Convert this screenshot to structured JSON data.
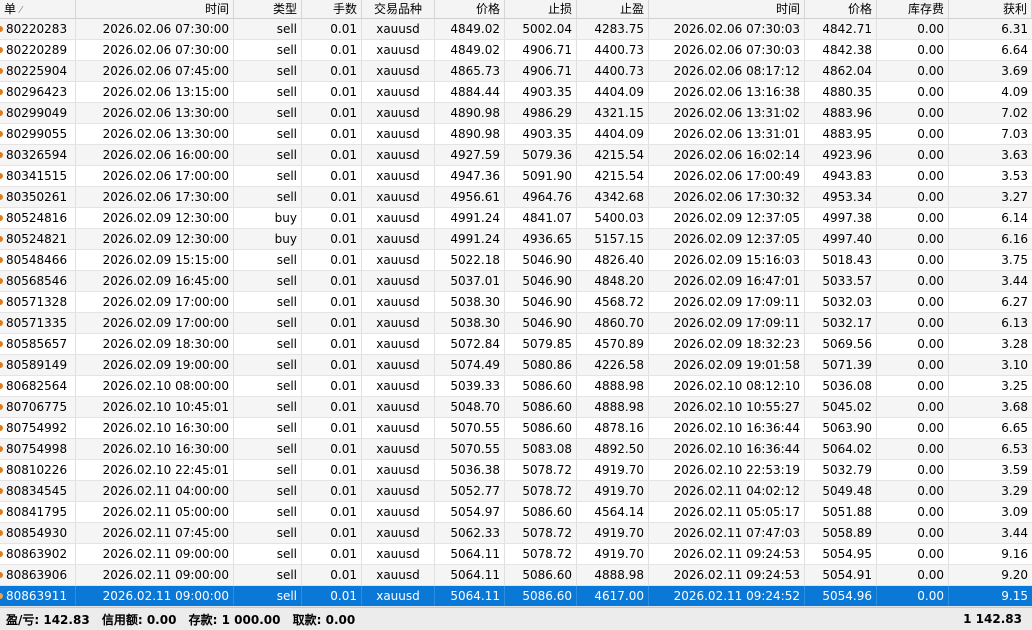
{
  "columns": [
    "单",
    "时间",
    "类型",
    "手数",
    "交易品种",
    "价格",
    "止损",
    "止盈",
    "时间",
    "价格",
    "库存费",
    "获利"
  ],
  "rows": [
    [
      "80220283",
      "2026.02.06 07:30:00",
      "sell",
      "0.01",
      "xauusd",
      "4849.02",
      "5002.04",
      "4283.75",
      "2026.02.06 07:30:03",
      "4842.71",
      "0.00",
      "6.31"
    ],
    [
      "80220289",
      "2026.02.06 07:30:00",
      "sell",
      "0.01",
      "xauusd",
      "4849.02",
      "4906.71",
      "4400.73",
      "2026.02.06 07:30:03",
      "4842.38",
      "0.00",
      "6.64"
    ],
    [
      "80225904",
      "2026.02.06 07:45:00",
      "sell",
      "0.01",
      "xauusd",
      "4865.73",
      "4906.71",
      "4400.73",
      "2026.02.06 08:17:12",
      "4862.04",
      "0.00",
      "3.69"
    ],
    [
      "80296423",
      "2026.02.06 13:15:00",
      "sell",
      "0.01",
      "xauusd",
      "4884.44",
      "4903.35",
      "4404.09",
      "2026.02.06 13:16:38",
      "4880.35",
      "0.00",
      "4.09"
    ],
    [
      "80299049",
      "2026.02.06 13:30:00",
      "sell",
      "0.01",
      "xauusd",
      "4890.98",
      "4986.29",
      "4321.15",
      "2026.02.06 13:31:02",
      "4883.96",
      "0.00",
      "7.02"
    ],
    [
      "80299055",
      "2026.02.06 13:30:00",
      "sell",
      "0.01",
      "xauusd",
      "4890.98",
      "4903.35",
      "4404.09",
      "2026.02.06 13:31:01",
      "4883.95",
      "0.00",
      "7.03"
    ],
    [
      "80326594",
      "2026.02.06 16:00:00",
      "sell",
      "0.01",
      "xauusd",
      "4927.59",
      "5079.36",
      "4215.54",
      "2026.02.06 16:02:14",
      "4923.96",
      "0.00",
      "3.63"
    ],
    [
      "80341515",
      "2026.02.06 17:00:00",
      "sell",
      "0.01",
      "xauusd",
      "4947.36",
      "5091.90",
      "4215.54",
      "2026.02.06 17:00:49",
      "4943.83",
      "0.00",
      "3.53"
    ],
    [
      "80350261",
      "2026.02.06 17:30:00",
      "sell",
      "0.01",
      "xauusd",
      "4956.61",
      "4964.76",
      "4342.68",
      "2026.02.06 17:30:32",
      "4953.34",
      "0.00",
      "3.27"
    ],
    [
      "80524816",
      "2026.02.09 12:30:00",
      "buy",
      "0.01",
      "xauusd",
      "4991.24",
      "4841.07",
      "5400.03",
      "2026.02.09 12:37:05",
      "4997.38",
      "0.00",
      "6.14"
    ],
    [
      "80524821",
      "2026.02.09 12:30:00",
      "buy",
      "0.01",
      "xauusd",
      "4991.24",
      "4936.65",
      "5157.15",
      "2026.02.09 12:37:05",
      "4997.40",
      "0.00",
      "6.16"
    ],
    [
      "80548466",
      "2026.02.09 15:15:00",
      "sell",
      "0.01",
      "xauusd",
      "5022.18",
      "5046.90",
      "4826.40",
      "2026.02.09 15:16:03",
      "5018.43",
      "0.00",
      "3.75"
    ],
    [
      "80568546",
      "2026.02.09 16:45:00",
      "sell",
      "0.01",
      "xauusd",
      "5037.01",
      "5046.90",
      "4848.20",
      "2026.02.09 16:47:01",
      "5033.57",
      "0.00",
      "3.44"
    ],
    [
      "80571328",
      "2026.02.09 17:00:00",
      "sell",
      "0.01",
      "xauusd",
      "5038.30",
      "5046.90",
      "4568.72",
      "2026.02.09 17:09:11",
      "5032.03",
      "0.00",
      "6.27"
    ],
    [
      "80571335",
      "2026.02.09 17:00:00",
      "sell",
      "0.01",
      "xauusd",
      "5038.30",
      "5046.90",
      "4860.70",
      "2026.02.09 17:09:11",
      "5032.17",
      "0.00",
      "6.13"
    ],
    [
      "80585657",
      "2026.02.09 18:30:00",
      "sell",
      "0.01",
      "xauusd",
      "5072.84",
      "5079.85",
      "4570.89",
      "2026.02.09 18:32:23",
      "5069.56",
      "0.00",
      "3.28"
    ],
    [
      "80589149",
      "2026.02.09 19:00:00",
      "sell",
      "0.01",
      "xauusd",
      "5074.49",
      "5080.86",
      "4226.58",
      "2026.02.09 19:01:58",
      "5071.39",
      "0.00",
      "3.10"
    ],
    [
      "80682564",
      "2026.02.10 08:00:00",
      "sell",
      "0.01",
      "xauusd",
      "5039.33",
      "5086.60",
      "4888.98",
      "2026.02.10 08:12:10",
      "5036.08",
      "0.00",
      "3.25"
    ],
    [
      "80706775",
      "2026.02.10 10:45:01",
      "sell",
      "0.01",
      "xauusd",
      "5048.70",
      "5086.60",
      "4888.98",
      "2026.02.10 10:55:27",
      "5045.02",
      "0.00",
      "3.68"
    ],
    [
      "80754992",
      "2026.02.10 16:30:00",
      "sell",
      "0.01",
      "xauusd",
      "5070.55",
      "5086.60",
      "4878.16",
      "2026.02.10 16:36:44",
      "5063.90",
      "0.00",
      "6.65"
    ],
    [
      "80754998",
      "2026.02.10 16:30:00",
      "sell",
      "0.01",
      "xauusd",
      "5070.55",
      "5083.08",
      "4892.50",
      "2026.02.10 16:36:44",
      "5064.02",
      "0.00",
      "6.53"
    ],
    [
      "80810226",
      "2026.02.10 22:45:01",
      "sell",
      "0.01",
      "xauusd",
      "5036.38",
      "5078.72",
      "4919.70",
      "2026.02.10 22:53:19",
      "5032.79",
      "0.00",
      "3.59"
    ],
    [
      "80834545",
      "2026.02.11 04:00:00",
      "sell",
      "0.01",
      "xauusd",
      "5052.77",
      "5078.72",
      "4919.70",
      "2026.02.11 04:02:12",
      "5049.48",
      "0.00",
      "3.29"
    ],
    [
      "80841795",
      "2026.02.11 05:00:00",
      "sell",
      "0.01",
      "xauusd",
      "5054.97",
      "5086.60",
      "4564.14",
      "2026.02.11 05:05:17",
      "5051.88",
      "0.00",
      "3.09"
    ],
    [
      "80854930",
      "2026.02.11 07:45:00",
      "sell",
      "0.01",
      "xauusd",
      "5062.33",
      "5078.72",
      "4919.70",
      "2026.02.11 07:47:03",
      "5058.89",
      "0.00",
      "3.44"
    ],
    [
      "80863902",
      "2026.02.11 09:00:00",
      "sell",
      "0.01",
      "xauusd",
      "5064.11",
      "5078.72",
      "4919.70",
      "2026.02.11 09:24:53",
      "5054.95",
      "0.00",
      "9.16"
    ],
    [
      "80863906",
      "2026.02.11 09:00:00",
      "sell",
      "0.01",
      "xauusd",
      "5064.11",
      "5086.60",
      "4888.98",
      "2026.02.11 09:24:53",
      "5054.91",
      "0.00",
      "9.20"
    ],
    [
      "80863911",
      "2026.02.11 09:00:00",
      "sell",
      "0.01",
      "xauusd",
      "5064.11",
      "5086.60",
      "4617.00",
      "2026.02.11 09:24:52",
      "5054.96",
      "0.00",
      "9.15"
    ]
  ],
  "selected_index": 27,
  "footer": {
    "profit_loss": "盈/亏: 142.83",
    "credit": "信用额: 0.00",
    "deposit": "存款: 1 000.00",
    "withdrawal": "取款: 0.00",
    "total": "1 142.83"
  },
  "colors": {
    "selected": "#0a78d7",
    "marker": "#e07a1a"
  }
}
